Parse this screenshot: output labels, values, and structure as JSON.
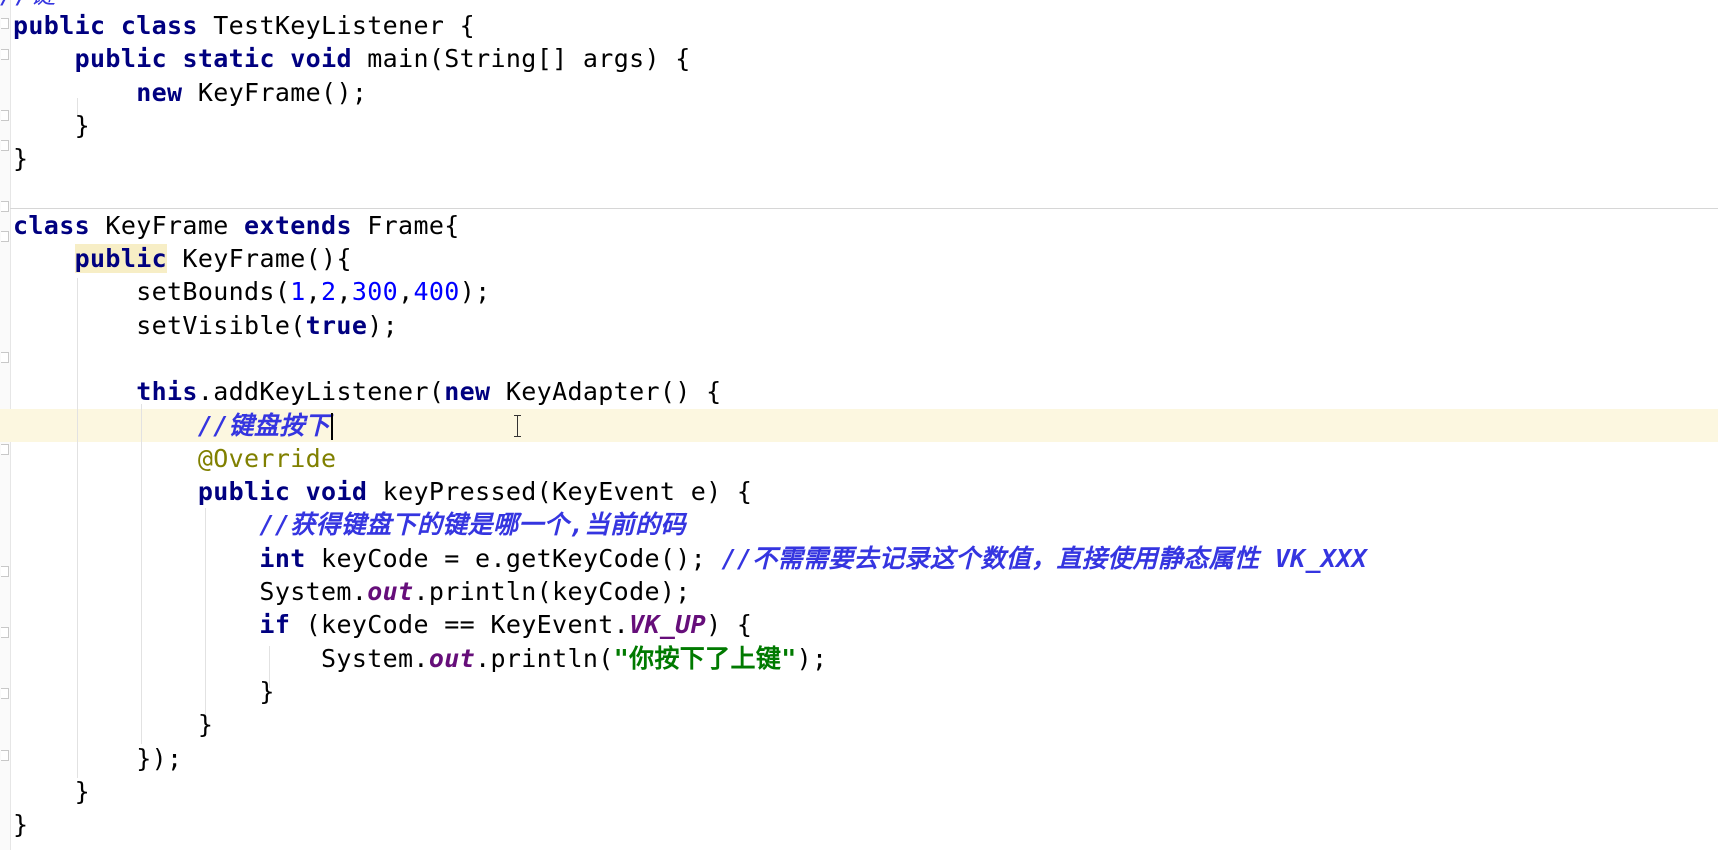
{
  "editor": {
    "top_partial": "//键",
    "lines": {
      "l1": [
        "public",
        " ",
        "class",
        " TestKeyListener {"
      ],
      "l2": [
        "    ",
        "public",
        " ",
        "static",
        " ",
        "void",
        " main(String[] args) {"
      ],
      "l3": [
        "        ",
        "new",
        " KeyFrame();"
      ],
      "l4": "    }",
      "l5": "}",
      "l7": [
        "class",
        " KeyFrame ",
        "extends",
        " Frame{"
      ],
      "l8": [
        "    ",
        "public",
        " KeyFrame(){"
      ],
      "l9": [
        "        setBounds(",
        "1",
        ",",
        "2",
        ",",
        "300",
        ",",
        "400",
        ");"
      ],
      "l10": [
        "        setVisible(",
        "true",
        ");"
      ],
      "l12": [
        "        ",
        "this",
        ".addKeyListener(",
        "new",
        " KeyAdapter() {"
      ],
      "l13": [
        "            ",
        "//键盘按下"
      ],
      "l14": [
        "            ",
        "@Override"
      ],
      "l15": [
        "            ",
        "public",
        " ",
        "void",
        " keyPressed(KeyEvent e) {"
      ],
      "l16": [
        "                ",
        "//获得键盘下的键是哪一个,当前的码"
      ],
      "l17": [
        "                ",
        "int",
        " keyCode = e.getKeyCode(); ",
        "//不需需要去记录这个数值，直接使用静态属性 ",
        "VK_XXX"
      ],
      "l18": [
        "                System.",
        "out",
        ".println(keyCode);"
      ],
      "l19": [
        "                ",
        "if",
        " (keyCode == KeyEvent.",
        "VK_UP",
        ") {"
      ],
      "l20": [
        "                    System.",
        "out",
        ".println(",
        "\"你按下了上键\"",
        ");"
      ],
      "l21": "                }",
      "l22": "            }",
      "l23": "        });",
      "l24": "    }",
      "l25": "}"
    }
  }
}
